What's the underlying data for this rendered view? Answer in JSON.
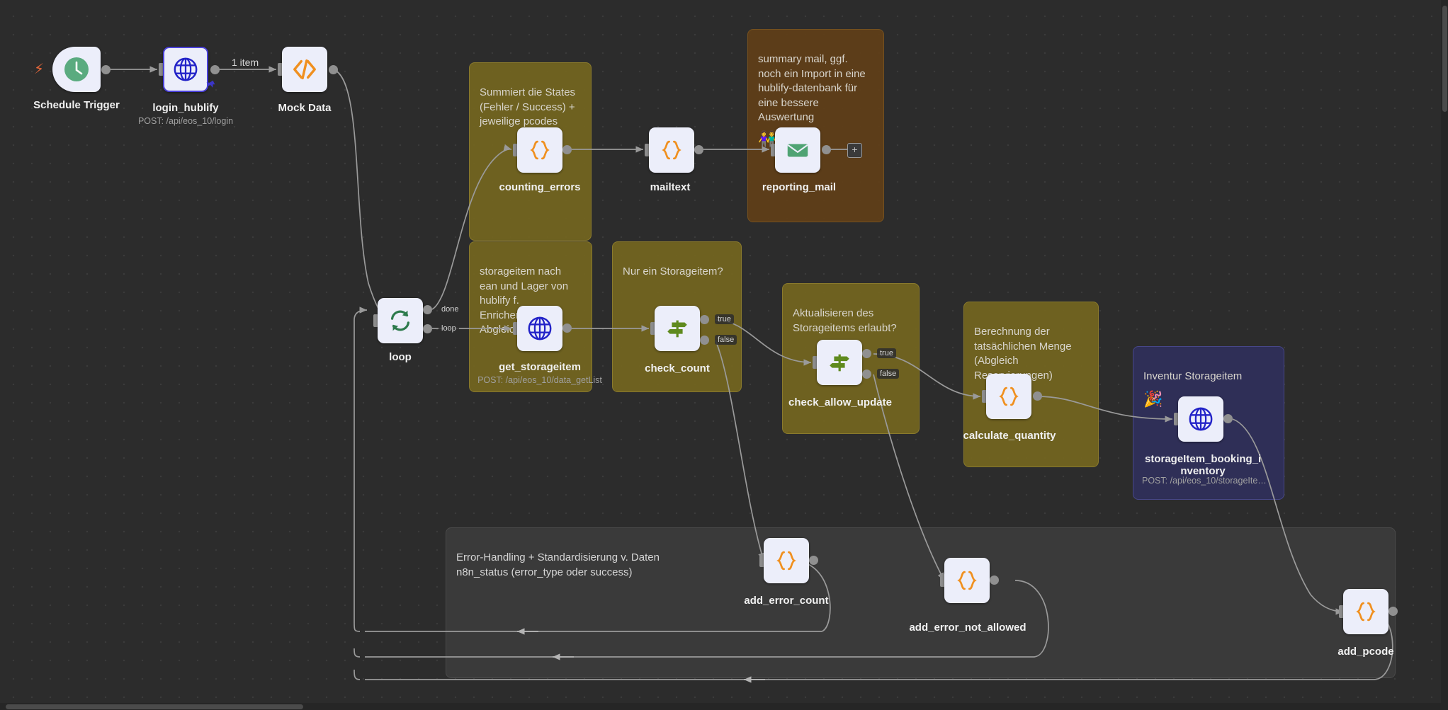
{
  "app": {
    "canvas_label": "n8n workflow canvas"
  },
  "colors": {
    "canvas_bg": "#2c2c2c",
    "node_bg": "#eceefa",
    "sticky_olive": "#74661f",
    "sticky_brown": "#5f3e18",
    "sticky_indigo": "#2f2f57",
    "sticky_grey": "#3a3a3a",
    "accent_orange": "#f0901f",
    "accent_blue": "#2323c8",
    "accent_green": "#4fa373",
    "connector_grey": "#9a9a9a",
    "selected_border": "#4b41d8"
  },
  "sticky_notes": [
    {
      "id": "note_counting",
      "color": "olive",
      "text": "Summiert die States (Fehler / Success) + jeweilige pcodes",
      "emoji": ""
    },
    {
      "id": "note_reporting",
      "color": "brown",
      "text": "summary mail, ggf. noch ein Import in eine hublify-datenbank für eine bessere Auswertung",
      "emoji": "👫"
    },
    {
      "id": "note_storage",
      "color": "olive",
      "text": "storageitem nach ean und Lager von hublify f. Enrichement und Abgleich",
      "emoji": ""
    },
    {
      "id": "note_count",
      "color": "olive",
      "text": "Nur ein Storageitem?",
      "emoji": ""
    },
    {
      "id": "note_allow",
      "color": "olive",
      "text": "Aktualisieren des Storageitems erlaubt?",
      "emoji": ""
    },
    {
      "id": "note_quantity",
      "color": "olive",
      "text": "Berechnung der tatsächlichen Menge (Abgleich Reservierungen)",
      "emoji": ""
    },
    {
      "id": "note_inventur",
      "color": "indigo",
      "text": "Inventur Storageitem",
      "emoji": "🎉"
    },
    {
      "id": "note_error",
      "color": "grey",
      "text": "Error-Handling + Standardisierung v. Daten\nn8n_status (error_type oder success)",
      "emoji": ""
    }
  ],
  "nodes": [
    {
      "id": "schedule_trigger",
      "label": "Schedule Trigger",
      "subtitle": "",
      "icon": "clock-icon",
      "selected": false
    },
    {
      "id": "login_hublify",
      "label": "login_hublify",
      "subtitle": "POST: /api/eos_10/login",
      "icon": "globe-icon",
      "selected": true
    },
    {
      "id": "mock_data",
      "label": "Mock Data",
      "subtitle": "",
      "icon": "code-icon",
      "selected": false
    },
    {
      "id": "counting_errors",
      "label": "counting_errors",
      "subtitle": "",
      "icon": "braces-icon",
      "selected": false
    },
    {
      "id": "mailtext",
      "label": "mailtext",
      "subtitle": "",
      "icon": "braces-icon",
      "selected": false
    },
    {
      "id": "reporting_mail",
      "label": "reporting_mail",
      "subtitle": "",
      "icon": "envelope-icon",
      "selected": false
    },
    {
      "id": "loop",
      "label": "loop",
      "subtitle": "",
      "icon": "refresh-icon",
      "selected": false
    },
    {
      "id": "get_storageitem",
      "label": "get_storageitem",
      "subtitle": "POST: /api/eos_10/data_getList",
      "icon": "globe-icon",
      "selected": false
    },
    {
      "id": "check_count",
      "label": "check_count",
      "subtitle": "",
      "icon": "signpost-icon",
      "selected": false
    },
    {
      "id": "check_allow_update",
      "label": "check_allow_update",
      "subtitle": "",
      "icon": "signpost-icon",
      "selected": false
    },
    {
      "id": "calculate_quantity",
      "label": "calculate_quantity",
      "subtitle": "",
      "icon": "braces-icon",
      "selected": false
    },
    {
      "id": "storageitem_booking_inventory",
      "label": "storageItem_booking_i\nnventory",
      "subtitle": "POST: /api/eos_10/storageIte…",
      "icon": "globe-icon",
      "selected": false
    },
    {
      "id": "add_error_count",
      "label": "add_error_count",
      "subtitle": "",
      "icon": "braces-icon",
      "selected": false
    },
    {
      "id": "add_error_not_allowed",
      "label": "add_error_not_allowed",
      "subtitle": "",
      "icon": "braces-icon",
      "selected": false
    },
    {
      "id": "add_pcode",
      "label": "add_pcode",
      "subtitle": "",
      "icon": "braces-icon",
      "selected": false
    }
  ],
  "edge_labels": {
    "login_to_mock": "1 item",
    "loop_done": "done",
    "loop_loop": "loop",
    "check_count_true": "true",
    "check_count_false": "false",
    "check_allow_true": "true",
    "check_allow_false": "false"
  },
  "buttons": {
    "add_node_plus": "+"
  },
  "indicators": {
    "trigger_bolt": "⚡",
    "pinned": "📌"
  }
}
